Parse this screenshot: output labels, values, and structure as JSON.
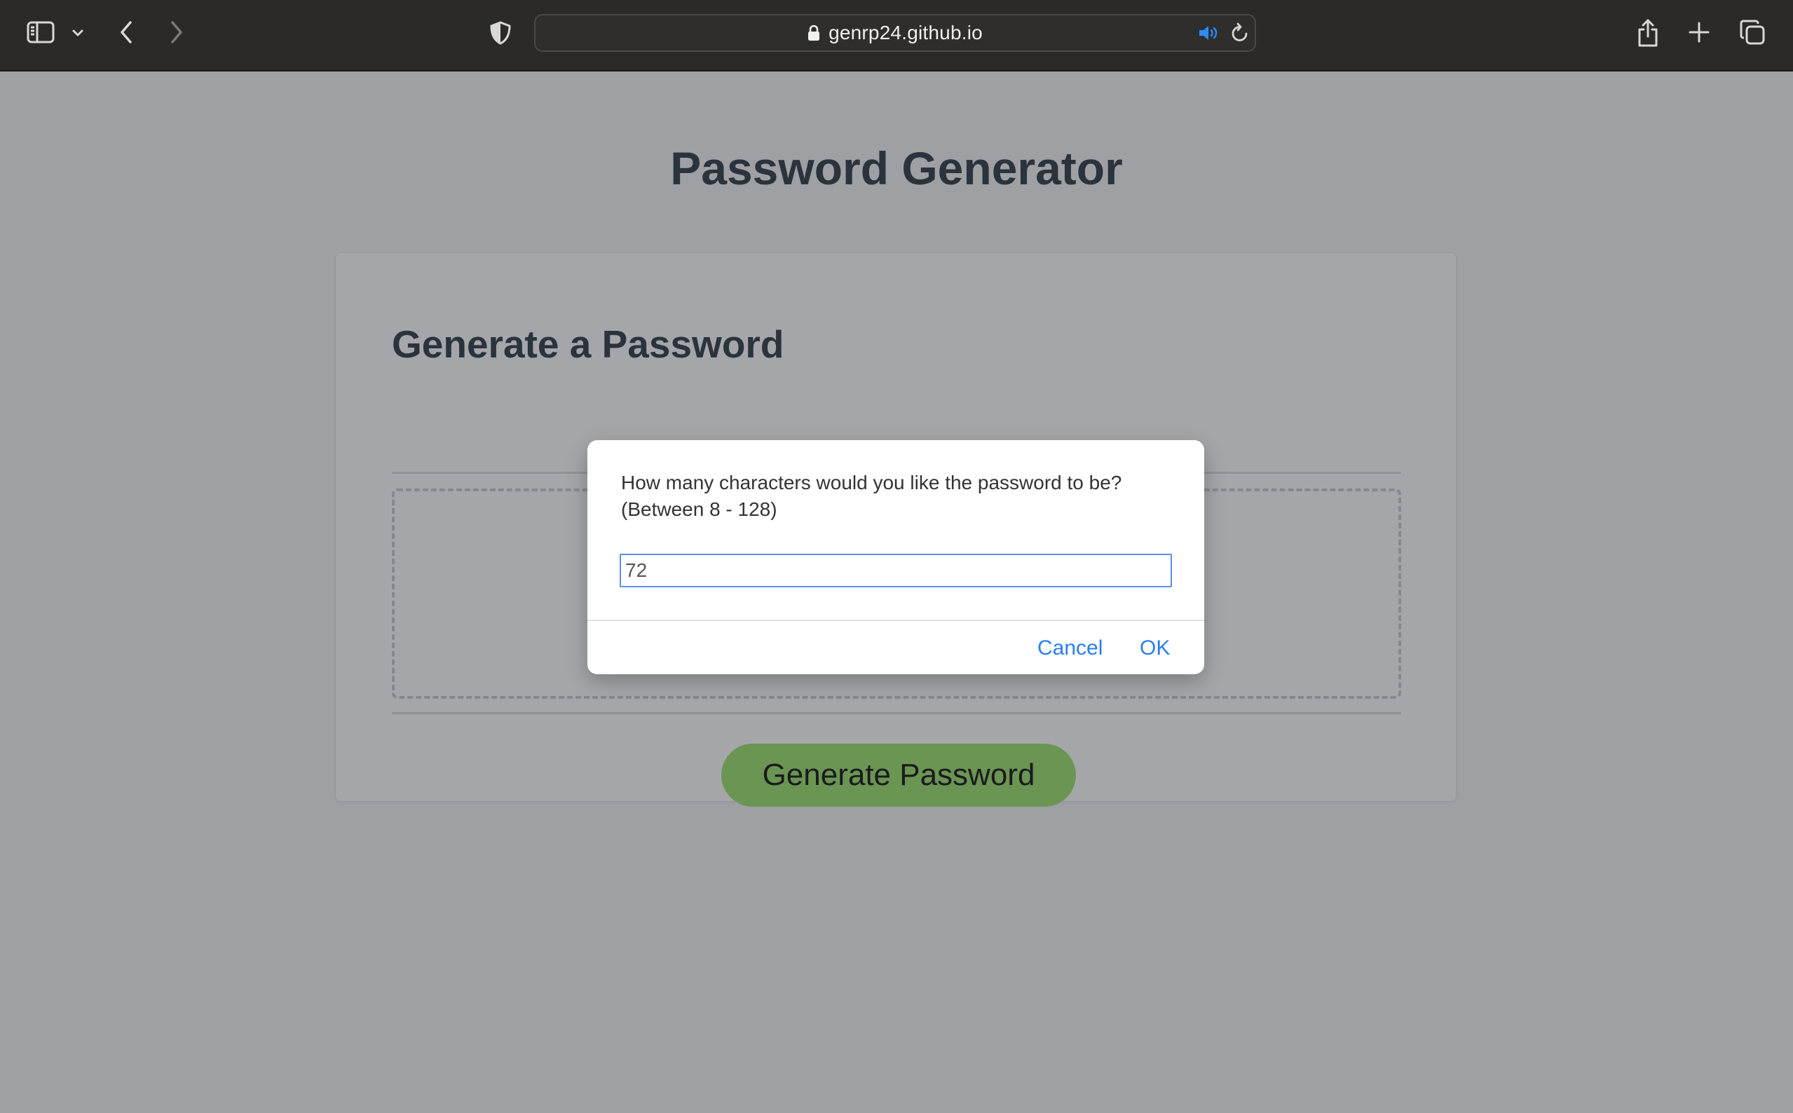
{
  "browser": {
    "url": "genrp24.github.io",
    "icons": {
      "sidebar": "sidebar-icon",
      "sidebar_menu": "chevron-down-icon",
      "back": "back-icon",
      "forward": "forward-icon",
      "privacy": "shield-icon",
      "lock": "lock-icon",
      "audio": "speaker-icon",
      "reload": "reload-icon",
      "share": "share-icon",
      "new_tab": "plus-icon",
      "tab_overview": "tabs-icon"
    },
    "colors": {
      "toolbar_bg": "#2b2a28",
      "audio_icon": "#2f8cff"
    }
  },
  "page": {
    "title": "Password Generator",
    "card": {
      "title": "Generate a Password",
      "password_output": ""
    },
    "generate_button_label": "Generate Password",
    "colors": {
      "generate_button": "#9be26a",
      "heading": "#2d3a46"
    }
  },
  "dialog": {
    "message_line1": "How many characters would you like the password to be?",
    "message_line2": "(Between 8 - 128)",
    "input_value": "72",
    "cancel_label": "Cancel",
    "ok_label": "OK",
    "colors": {
      "button_text": "#2a7ef0",
      "input_border": "#5a8ff0"
    }
  }
}
